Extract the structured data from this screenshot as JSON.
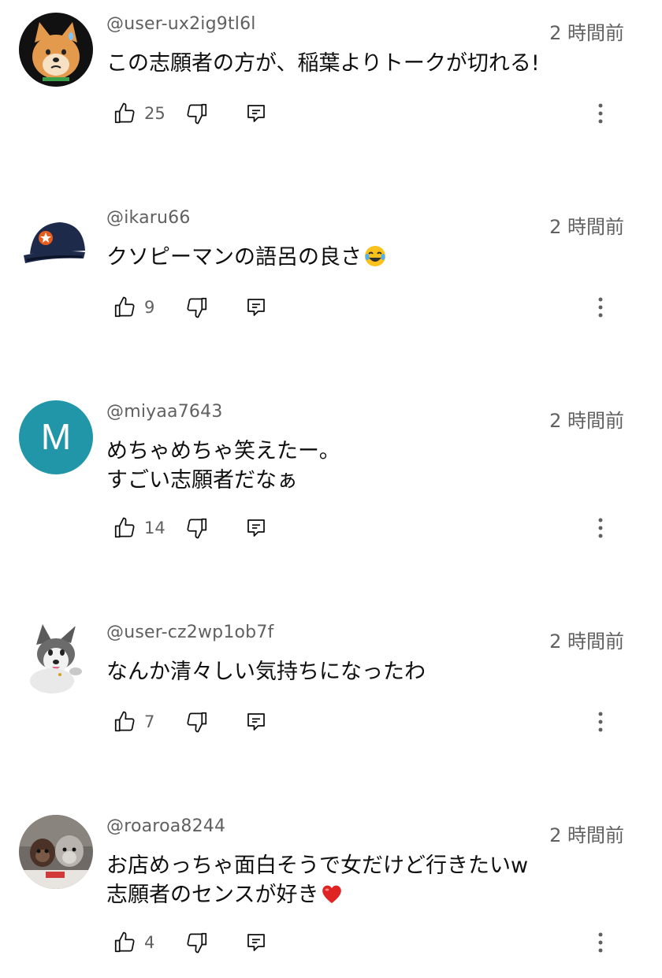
{
  "comments": [
    {
      "username": "@user-ux2ig9tl6l",
      "time": "2 時間前",
      "text": "この志願者の方が、稲葉よりトークが切れる!",
      "likes": "25",
      "avatar_icon": "shiba-dog-avatar"
    },
    {
      "username": "@ikaru66",
      "time": "2 時間前",
      "text": "クソピーマンの語呂の良さ",
      "emoji": "😂",
      "likes": "9",
      "avatar_icon": "baseball-cap-avatar"
    },
    {
      "username": "@miyaa7643",
      "time": "2 時間前",
      "text": "めちゃめちゃ笑えたー。\nすごい志願者だなぁ",
      "likes": "14",
      "avatar_letter": "M",
      "avatar_color": "#2196a8"
    },
    {
      "username": "@user-cz2wp1ob7f",
      "time": "2 時間前",
      "text": "なんか清々しい気持ちになったわ",
      "likes": "7",
      "avatar_icon": "husky-avatar"
    },
    {
      "username": "@roaroa8244",
      "time": "2 時間前",
      "text": "お店めっちゃ面白そうで女だけど行きたいw\n志願者のセンスが好き",
      "emoji": "❤️",
      "likes": "4",
      "avatar_icon": "dogs-photo-avatar"
    }
  ],
  "colors": {
    "secondary_text": "#606060",
    "primary_text": "#0f0f0f",
    "background": "#ffffff"
  }
}
